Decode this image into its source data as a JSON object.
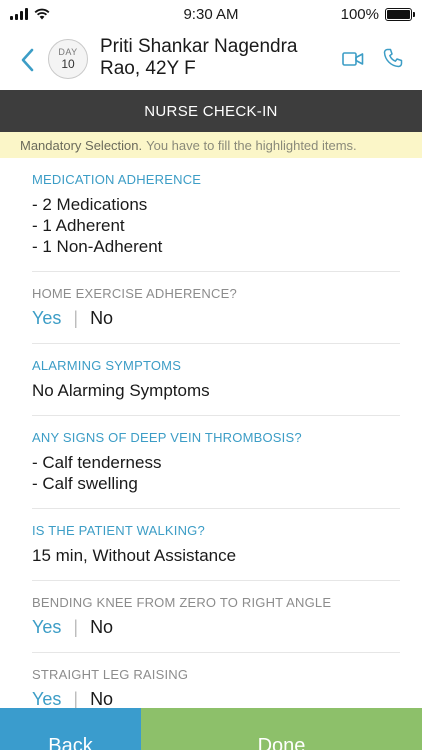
{
  "status_bar": {
    "time": "9:30 AM",
    "battery": "100%"
  },
  "header": {
    "day_label": "DAY",
    "day_number": "10",
    "patient_name": "Priti Shankar Nagendra Rao, 42Y F"
  },
  "title": "NURSE CHECK-IN",
  "notice": {
    "strong": "Mandatory Selection.",
    "text": "You have to fill the highlighted items."
  },
  "sections": [
    {
      "label": "MEDICATION ADHERENCE",
      "lines": [
        "- 2 Medications",
        "- 1 Adherent",
        "- 1 Non-Adherent"
      ]
    },
    {
      "label": "HOME EXERCISE ADHERENCE?",
      "yes": "Yes",
      "no": "No"
    },
    {
      "label": "ALARMING SYMPTOMS",
      "lines": [
        "No Alarming Symptoms"
      ]
    },
    {
      "label": "ANY SIGNS OF DEEP VEIN THROMBOSIS?",
      "lines": [
        "- Calf tenderness",
        "- Calf swelling"
      ]
    },
    {
      "label": "IS THE PATIENT WALKING?",
      "lines": [
        "15 min, Without Assistance"
      ]
    },
    {
      "label": "BENDING KNEE FROM ZERO TO RIGHT ANGLE",
      "yes": "Yes",
      "no": "No"
    },
    {
      "label": "STRAIGHT LEG RAISING",
      "yes": "Yes",
      "no": "No"
    }
  ],
  "footer": {
    "back_label": "Back",
    "done_label": "Done"
  },
  "colors": {
    "accent_blue": "#3c9dc6",
    "done_green": "#8dc06a",
    "title_bar": "#3d3d3d",
    "notice_bg": "#fbf6c8"
  },
  "icons": [
    "cellular-signal-icon",
    "wifi-icon",
    "battery-icon",
    "chevron-left-icon",
    "video-camera-icon",
    "phone-icon"
  ]
}
